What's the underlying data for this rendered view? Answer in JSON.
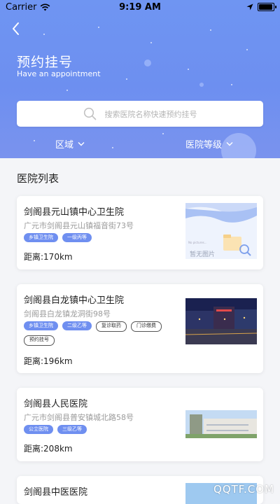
{
  "status_bar": {
    "carrier": "Carrier",
    "time": "9:19 AM"
  },
  "header": {
    "title": "预约挂号",
    "subtitle": "Have an appointment",
    "search_placeholder": "搜索医院名称快速预约挂号",
    "filters": {
      "area": "区域",
      "level": "医院等级"
    }
  },
  "section_title": "医院列表",
  "hospitals": [
    {
      "name": "剑阁县元山镇中心卫生院",
      "address": "广元市剑阁县元山镇福音街73号",
      "tags": [
        "乡镇卫生院",
        "一级丙等"
      ],
      "distance": "距离:170km",
      "image_caption": "暂无图片",
      "image_note": "No pictures..."
    },
    {
      "name": "剑阁县白龙镇中心卫生院",
      "address": "剑阁县白龙镇龙洞街98号",
      "tags": [
        "乡镇卫生院",
        "二级乙等"
      ],
      "services": [
        "复诊取药",
        "门诊缴费",
        "预约挂号"
      ],
      "distance": "距离:196km"
    },
    {
      "name": "剑阁县人民医院",
      "address": "广元市剑阁县普安镇城北路58号",
      "tags": [
        "公立医院",
        "三级乙等"
      ],
      "distance": "距离:208km"
    },
    {
      "name": "剑阁县中医医院"
    }
  ],
  "watermark": "QQTF.COM",
  "colors": {
    "primary": "#6f8ff0",
    "header_bg": "#6f95f2"
  }
}
